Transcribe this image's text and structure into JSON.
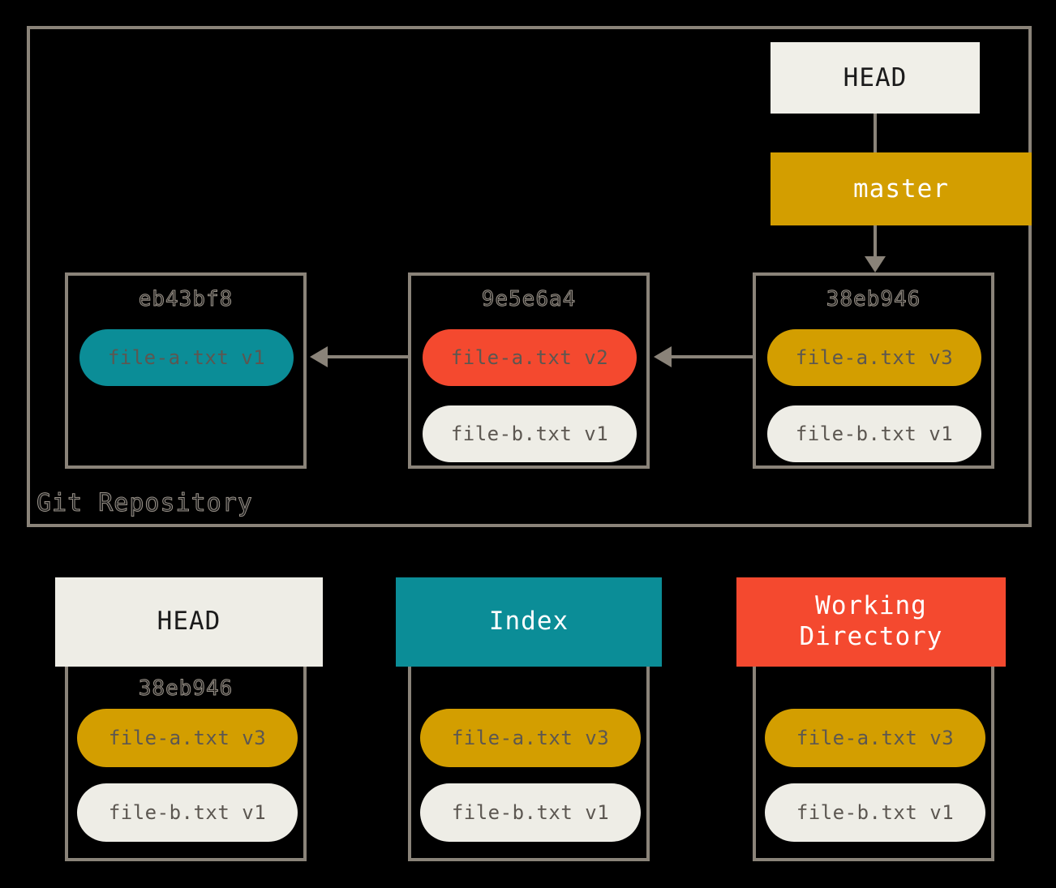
{
  "diagram": {
    "title": "Git Repository",
    "colors": {
      "background": "#000000",
      "line": "#8a8379",
      "teal": "#0b8d97",
      "red": "#f4492f",
      "gold": "#d39e00",
      "cream": "#eeede6",
      "text_gray": "#5c5751"
    }
  },
  "repository": {
    "label": "Git Repository",
    "head_pointer": "HEAD",
    "branch": "master",
    "commits": [
      {
        "hash": "eb43bf8",
        "files": [
          {
            "label": "file-a.txt v1",
            "color": "teal"
          }
        ]
      },
      {
        "hash": "9e5e6a4",
        "files": [
          {
            "label": "file-a.txt v2",
            "color": "red"
          },
          {
            "label": "file-b.txt v1",
            "color": "cream"
          }
        ]
      },
      {
        "hash": "38eb946",
        "files": [
          {
            "label": "file-a.txt v3",
            "color": "gold"
          },
          {
            "label": "file-b.txt v1",
            "color": "cream"
          }
        ]
      }
    ]
  },
  "areas": [
    {
      "title": "HEAD",
      "hash": "38eb946",
      "header_bg": "#eeede6",
      "header_fg": "#1b1b1b",
      "files": [
        {
          "label": "file-a.txt v3",
          "color": "gold"
        },
        {
          "label": "file-b.txt v1",
          "color": "cream"
        }
      ]
    },
    {
      "title": "Index",
      "hash": "",
      "header_bg": "#0b8d97",
      "header_fg": "#ffffff",
      "files": [
        {
          "label": "file-a.txt v3",
          "color": "gold"
        },
        {
          "label": "file-b.txt v1",
          "color": "cream"
        }
      ]
    },
    {
      "title": "Working\nDirectory",
      "title_line1": "Working",
      "title_line2": "Directory",
      "hash": "",
      "header_bg": "#f4492f",
      "header_fg": "#ffffff",
      "files": [
        {
          "label": "file-a.txt v3",
          "color": "gold"
        },
        {
          "label": "file-b.txt v1",
          "color": "cream"
        }
      ]
    }
  ]
}
